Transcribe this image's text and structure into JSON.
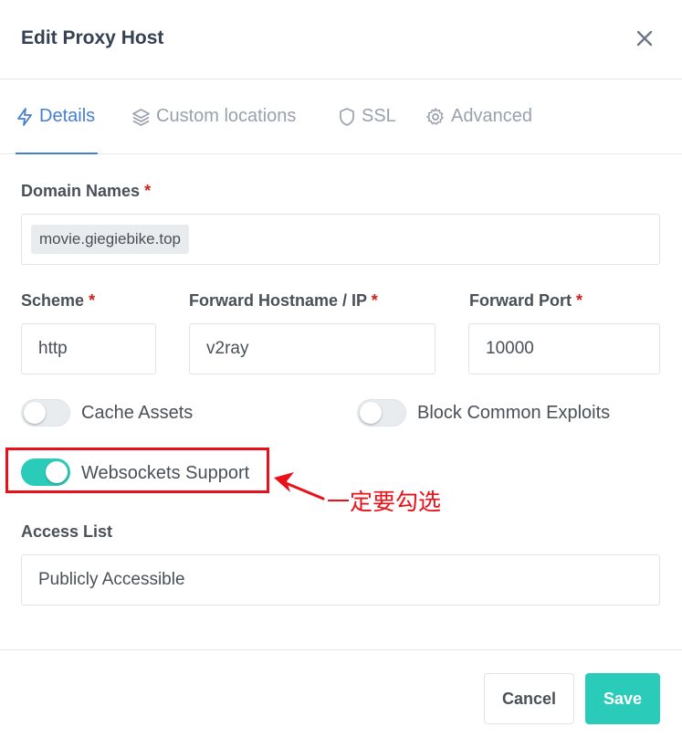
{
  "header": {
    "title": "Edit Proxy Host"
  },
  "tabs": [
    {
      "label": "Details",
      "icon": "lightning-icon",
      "active": true
    },
    {
      "label": "Custom locations",
      "icon": "layers-icon",
      "active": false
    },
    {
      "label": "SSL",
      "icon": "shield-icon",
      "active": false
    },
    {
      "label": "Advanced",
      "icon": "gear-icon",
      "active": false
    }
  ],
  "form": {
    "required_mark": "*",
    "domain_names": {
      "label": "Domain Names",
      "chips": [
        "movie.giegiebike.top"
      ]
    },
    "scheme": {
      "label": "Scheme",
      "value": "http"
    },
    "forward_hostname": {
      "label": "Forward Hostname / IP",
      "value": "v2ray"
    },
    "forward_port": {
      "label": "Forward Port",
      "value": "10000"
    },
    "toggles": {
      "cache_assets": {
        "label": "Cache Assets",
        "on": false
      },
      "block_exploits": {
        "label": "Block Common Exploits",
        "on": false
      },
      "websockets": {
        "label": "Websockets Support",
        "on": true
      }
    },
    "access_list": {
      "label": "Access List",
      "value": "Publicly Accessible"
    }
  },
  "annotation": {
    "text": "一定要勾选",
    "color": "#e8111a"
  },
  "footer": {
    "cancel_label": "Cancel",
    "save_label": "Save"
  },
  "colors": {
    "accent": "#467fcf",
    "toggle_on": "#2bcbba",
    "required": "#cd201f"
  }
}
